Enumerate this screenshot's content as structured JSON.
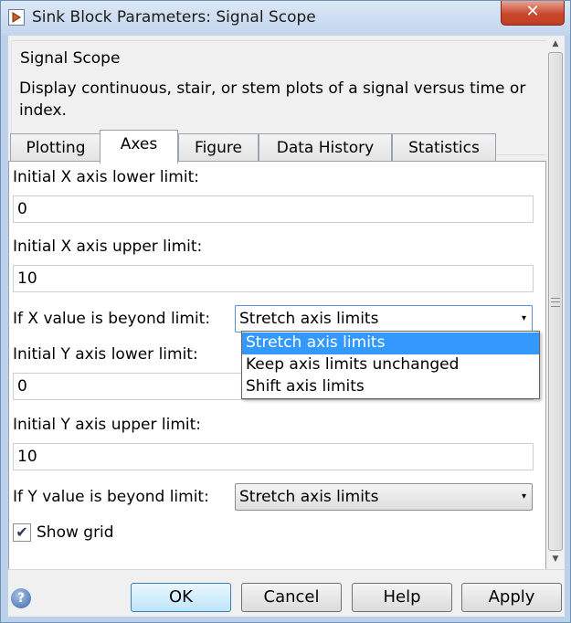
{
  "window": {
    "title": "Sink Block Parameters: Signal Scope",
    "close_label": "✕"
  },
  "group": {
    "title": "Signal Scope",
    "description": "Display continuous, stair, or stem plots of a signal versus time or index."
  },
  "tabs": [
    {
      "label": "Plotting"
    },
    {
      "label": "Axes",
      "active": true
    },
    {
      "label": "Figure"
    },
    {
      "label": "Data History"
    },
    {
      "label": "Statistics"
    }
  ],
  "axes": {
    "x_lower_label": "Initial X axis lower limit:",
    "x_lower_value": "0",
    "x_upper_label": "Initial X axis upper limit:",
    "x_upper_value": "10",
    "x_beyond_label": "If X value is beyond limit:",
    "x_beyond_value": "Stretch axis limits",
    "y_lower_label": "Initial Y axis lower limit:",
    "y_lower_value": "0",
    "y_upper_label": "Initial Y axis upper limit:",
    "y_upper_value": "10",
    "y_beyond_label": "If Y value is beyond limit:",
    "y_beyond_value": "Stretch axis limits",
    "show_grid_label": "Show grid",
    "show_grid_checked": true,
    "checkmark": "✔"
  },
  "dropdown": {
    "options": [
      {
        "label": "Stretch axis limits",
        "selected": true
      },
      {
        "label": "Keep axis limits unchanged"
      },
      {
        "label": "Shift axis limits"
      }
    ]
  },
  "buttons": {
    "ok": "OK",
    "cancel": "Cancel",
    "help": "Help",
    "apply": "Apply",
    "help_icon_glyph": "?"
  },
  "icons": {
    "app": "simulink-block-icon",
    "help": "help-icon",
    "close": "close-icon",
    "dropdown_arrow": "▾",
    "scroll_up": "▲",
    "scroll_down": "▼"
  },
  "colors": {
    "title_bar": "#c3d6ee",
    "close_button": "#c8472c",
    "selection": "#3399ff"
  }
}
